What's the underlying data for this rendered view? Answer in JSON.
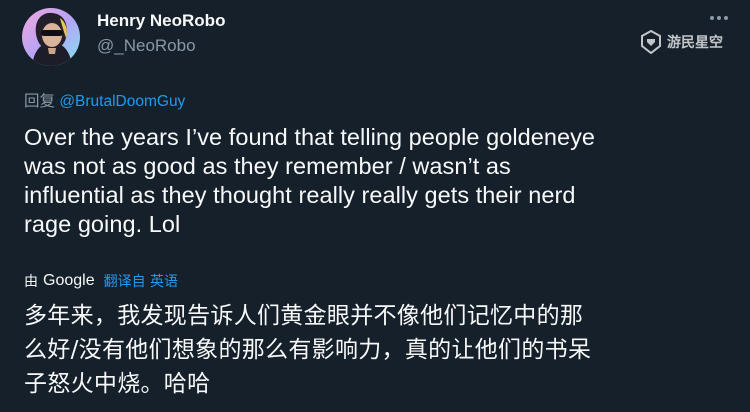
{
  "author": {
    "display_name": "Henry NeoRobo",
    "handle": "@_NeoRobo"
  },
  "watermark": {
    "text": "游民星空"
  },
  "reply": {
    "prefix": "回复 ",
    "mention": "@BrutalDoomGuy"
  },
  "tweet": {
    "lines": [
      "Over the years I’ve found that telling people goldeneye",
      "was not as good as they remember / wasn’t as",
      "influential as they thought really really gets their nerd",
      "rage going. Lol"
    ]
  },
  "translation": {
    "by_label": "由",
    "provider": "Google",
    "source_label": "翻译自 英语",
    "lines": [
      "多年来，我发现告诉人们黄金眼并不像他们记忆中的那",
      "么好/没有他们想象的那么有影响力，真的让他们的书呆",
      "子怒火中烧。哈哈"
    ]
  },
  "colors": {
    "background": "#15202b",
    "text": "#f7f9f9",
    "secondary": "#8b98a5",
    "accent": "#1d9bf0"
  },
  "icons": {
    "more": "more-horizontal-icon",
    "watermark": "gamersky-logo-icon"
  }
}
